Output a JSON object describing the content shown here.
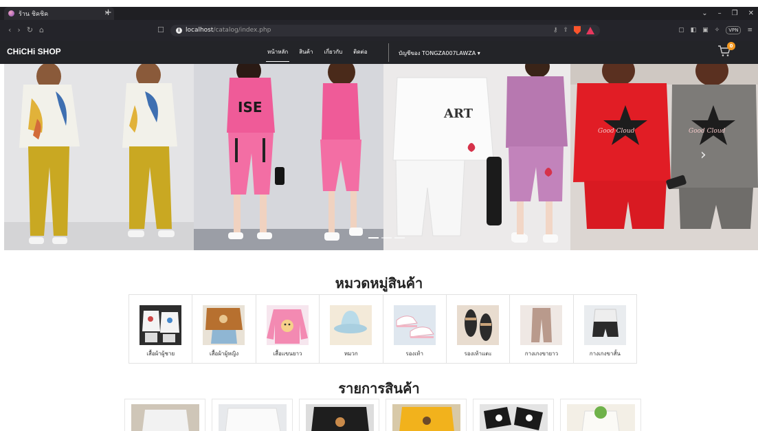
{
  "browser": {
    "tab_title": "ร้าน ชิคชิค",
    "url_host": "localhost",
    "url_path": "/catalog/index.php",
    "vpn_label": "VPN"
  },
  "site": {
    "brand": "CHiCHi SHOP",
    "nav": [
      {
        "label": "หน้าหลัก",
        "active": true
      },
      {
        "label": "สินค้า",
        "active": false
      },
      {
        "label": "เกี่ยวกับ",
        "active": false
      },
      {
        "label": "ติดต่อ",
        "active": false
      }
    ],
    "account_label": "บัญชีของ TONGZA007LAWZA",
    "cart_count": "0"
  },
  "hero": {
    "slides_total": 3,
    "active_slide": 1,
    "caption_words": [
      "ISE",
      "ART",
      "Good Cloud",
      "Good Cloud"
    ]
  },
  "categories": {
    "title": "หมวดหมู่สินค้า",
    "items": [
      {
        "label": "เสื้อผ้าผู้ชาย",
        "icon": "men-clothes-photo"
      },
      {
        "label": "เสื้อผ้าผู้หญิง",
        "icon": "women-clothes-photo"
      },
      {
        "label": "เสื้อแขนยาว",
        "icon": "long-sleeve-photo"
      },
      {
        "label": "หมวก",
        "icon": "hat-photo"
      },
      {
        "label": "รองเท้า",
        "icon": "shoes-photo"
      },
      {
        "label": "รองเท้าแตะ",
        "icon": "sandals-photo"
      },
      {
        "label": "กางเกงขายาว",
        "icon": "long-pants-photo"
      },
      {
        "label": "กางเกงขาสั้น",
        "icon": "shorts-photo"
      }
    ]
  },
  "products": {
    "title": "รายการสินค้า",
    "count": 6
  }
}
